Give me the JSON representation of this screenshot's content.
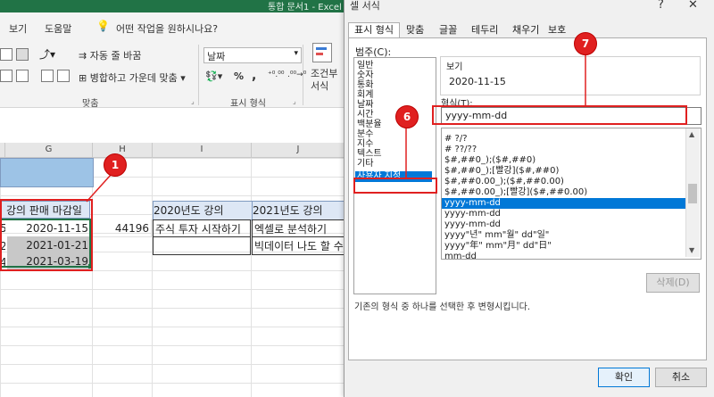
{
  "window": {
    "title": "통합 문서1  -  Excel"
  },
  "ribbon": {
    "tabs": [
      "보기",
      "도움말"
    ],
    "tell_me": "어떤 작업을 원하시나요?",
    "wrap_text": "자동 줄 바꿈",
    "merge_center": "병합하고 가운데 맞춤",
    "number_format_value": "날짜",
    "percent": "%",
    "comma": ",",
    "conditional_format": "조건부",
    "format_label": "서식",
    "align_group": "맞춤",
    "number_group": "표시 형식"
  },
  "sheet": {
    "columns": [
      "G",
      "H",
      "I",
      "J"
    ],
    "header_cells": {
      "g": "강의 판매 마감일",
      "i": "2020년도 강의",
      "j": "2021년도 강의"
    },
    "row_edge": [
      "5",
      "2",
      "4"
    ],
    "dates": [
      "2020-11-15",
      "2021-01-21",
      "2021-03-19"
    ],
    "h_value": "44196",
    "i_value": "주식 투자 시작하기",
    "j_values": [
      "엑셀로 분석하기",
      "빅데이터 나도 할 수"
    ]
  },
  "dialog": {
    "title": "셀 서식",
    "help": "?",
    "close": "✕",
    "tabs": [
      "표시 형식",
      "맞춤",
      "글꼴",
      "테두리",
      "채우기",
      "보호"
    ],
    "category_label": "범주(C):",
    "categories": [
      "일반",
      "숫자",
      "통화",
      "회계",
      "날짜",
      "시간",
      "백분율",
      "분수",
      "지수",
      "텍스트",
      "기타",
      "사용자 지정"
    ],
    "sample_label": "보기",
    "sample_value": "2020-11-15",
    "type_label": "형식(T):",
    "type_value": "yyyy-mm-dd",
    "formats": [
      "# ?/?",
      "# ??/??",
      "$#,##0_);($#,##0)",
      "$#,##0_);[빨강]($#,##0)",
      "$#,##0.00_);($#,##0.00)",
      "$#,##0.00_);[빨강]($#,##0.00)",
      "yyyy-mm-dd",
      "yyyy-mm-dd",
      "yyyy-mm-dd",
      "yyyy\"년\" mm\"월\" dd\"일\"",
      "yyyy\"年\" mm\"月\" dd\"日\"",
      "mm-dd"
    ],
    "delete_button": "삭제(D)",
    "description": "기존의 형식 중 하나를 선택한 후 변형시킵니다.",
    "ok_button": "확인",
    "cancel_button": "취소"
  },
  "annotations": {
    "badge1": "1",
    "badge6": "6",
    "badge7": "7"
  },
  "colors": {
    "excel_green": "#217346",
    "selection_blue": "#0078d7",
    "annotation_red": "#e02020"
  }
}
